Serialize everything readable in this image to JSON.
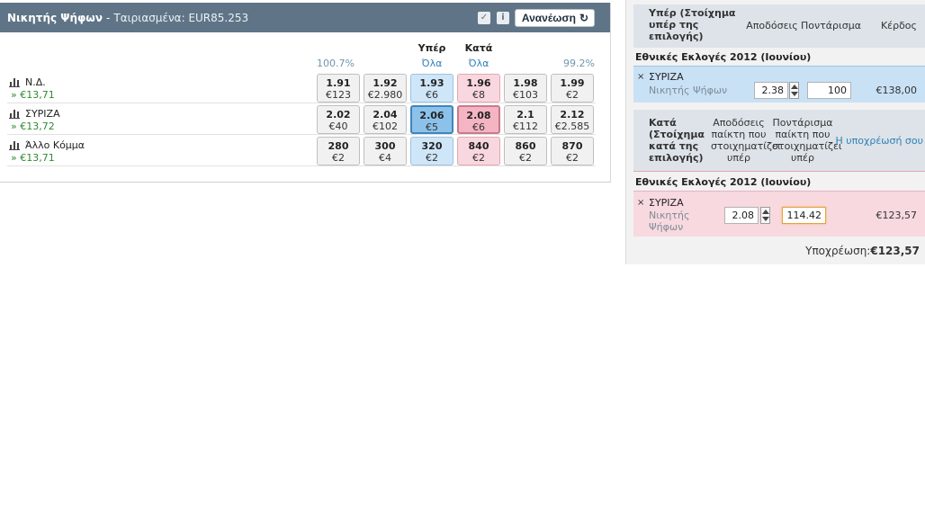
{
  "market": {
    "name": "Νικητής Ψήφων",
    "separator": "-",
    "matched": "Ταιριασμένα: EUR85.253",
    "refresh_label": "Ανανέωση",
    "icons": [
      "checkbox-icon",
      "info-icon",
      "refresh-icon"
    ],
    "back_header": "Υπέρ",
    "lay_header": "Κατά",
    "back_all": "Όλα",
    "lay_all": "Όλα",
    "back_book": "100.7%",
    "lay_book": "99.2%",
    "runners": [
      {
        "name": "Ν.Δ.",
        "pl": "» €13,71",
        "prices": [
          {
            "odds": "1.91",
            "vol": "€123"
          },
          {
            "odds": "1.92",
            "vol": "€2.980"
          },
          {
            "odds": "1.93",
            "vol": "€6"
          },
          {
            "odds": "1.96",
            "vol": "€8"
          },
          {
            "odds": "1.98",
            "vol": "€103"
          },
          {
            "odds": "1.99",
            "vol": "€2"
          }
        ]
      },
      {
        "name": "ΣΥΡΙΖΑ",
        "pl": "» €13,72",
        "prices": [
          {
            "odds": "2.02",
            "vol": "€40"
          },
          {
            "odds": "2.04",
            "vol": "€102"
          },
          {
            "odds": "2.06",
            "vol": "€5"
          },
          {
            "odds": "2.08",
            "vol": "€6"
          },
          {
            "odds": "2.1",
            "vol": "€112"
          },
          {
            "odds": "2.12",
            "vol": "€2.585"
          }
        ]
      },
      {
        "name": "Άλλο Κόμμα",
        "pl": "» €13,71",
        "prices": [
          {
            "odds": "280",
            "vol": "€2"
          },
          {
            "odds": "300",
            "vol": "€4"
          },
          {
            "odds": "320",
            "vol": "€2"
          },
          {
            "odds": "840",
            "vol": "€2"
          },
          {
            "odds": "860",
            "vol": "€2"
          },
          {
            "odds": "870",
            "vol": "€2"
          }
        ]
      }
    ]
  },
  "betslip": {
    "back_header": {
      "title": "Υπέρ (Στοίχημα υπέρ της επιλογής)",
      "odds": "Αποδόσεις",
      "stake": "Ποντάρισμα",
      "profit": "Κέρδος"
    },
    "back_market": "Εθνικές Εκλογές 2012 (Ιουνίου)",
    "back_bet": {
      "close": "×",
      "selection": "ΣΥΡΙΖΑ",
      "market": "Νικητής Ψήφων",
      "odds": "2.38",
      "stake": "100",
      "profit": "€138,00"
    },
    "lay_header": {
      "title": "Κατά (Στοίχημα κατά της επιλογής)",
      "odds": "Αποδόσεις παίκτη που στοιχηματίζει υπέρ",
      "stake": "Ποντάρισμα παίκτη που στοιχηματίζει υπέρ",
      "liability": "Η υποχρέωσή σου"
    },
    "lay_market": "Εθνικές Εκλογές 2012 (Ιουνίου)",
    "lay_bet": {
      "close": "×",
      "selection": "ΣΥΡΙΖΑ",
      "market": "Νικητής Ψήφων",
      "odds": "2.08",
      "stake": "114.42",
      "liability": "€123,57"
    },
    "total_label": "Υποχρέωση:",
    "total_value": "€123,57"
  },
  "colors": {
    "header_bg": "#5f7587",
    "back": "#cfe6f8",
    "lay": "#f9d7de",
    "back_selected": "#8cc2ea",
    "lay_selected": "#f4b4c2",
    "pl_green": "#2e8a2e",
    "link": "#2f7fb8"
  }
}
